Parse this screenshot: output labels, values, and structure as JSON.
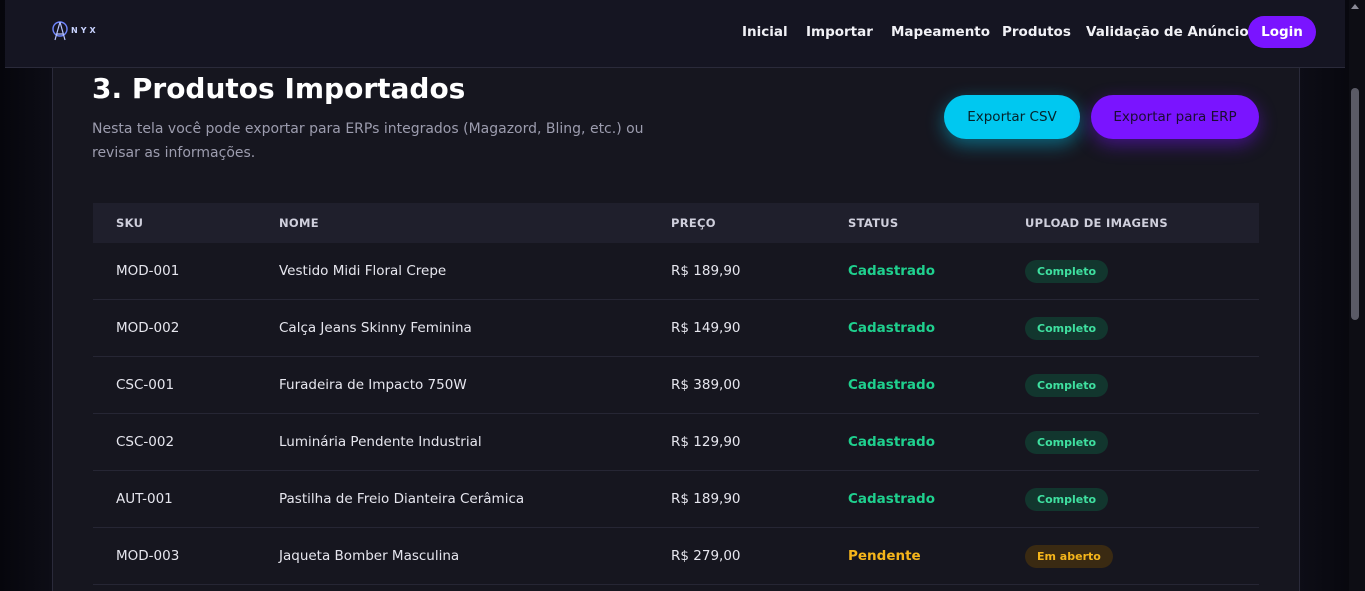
{
  "brand": {
    "logo_text": "NYX"
  },
  "nav": {
    "links": [
      "Inicial",
      "Importar",
      "Mapeamento",
      "Produtos",
      "Validação de Anúncio"
    ],
    "login_label": "Login"
  },
  "page": {
    "title": "3. Produtos Importados",
    "description": "Nesta tela você pode exportar para ERPs integrados (Magazord, Bling, etc.) ou revisar as informações.",
    "export_csv_label": "Exportar CSV",
    "export_erp_label": "Exportar para ERP"
  },
  "table": {
    "headers": [
      "SKU",
      "NOME",
      "PREÇO",
      "STATUS",
      "UPLOAD DE IMAGENS"
    ],
    "rows": [
      {
        "sku": "MOD-001",
        "nome": "Vestido Midi Floral Crepe",
        "preco": "R$ 189,90",
        "status": "Cadastrado",
        "upload": "Completo",
        "state": "ok"
      },
      {
        "sku": "MOD-002",
        "nome": "Calça Jeans Skinny Feminina",
        "preco": "R$ 149,90",
        "status": "Cadastrado",
        "upload": "Completo",
        "state": "ok"
      },
      {
        "sku": "CSC-001",
        "nome": "Furadeira de Impacto 750W",
        "preco": "R$ 389,00",
        "status": "Cadastrado",
        "upload": "Completo",
        "state": "ok"
      },
      {
        "sku": "CSC-002",
        "nome": "Luminária Pendente Industrial",
        "preco": "R$ 129,90",
        "status": "Cadastrado",
        "upload": "Completo",
        "state": "ok"
      },
      {
        "sku": "AUT-001",
        "nome": "Pastilha de Freio Dianteira Cerâmica",
        "preco": "R$ 189,90",
        "status": "Cadastrado",
        "upload": "Completo",
        "state": "ok"
      },
      {
        "sku": "MOD-003",
        "nome": "Jaqueta Bomber Masculina",
        "preco": "R$ 279,00",
        "status": "Pendente",
        "upload": "Em aberto",
        "state": "pend"
      }
    ]
  },
  "colors": {
    "accent_purple": "#7a14ff",
    "accent_cyan": "#00c8f0",
    "status_ok": "#1fd08e",
    "status_pending": "#f5b51b"
  }
}
